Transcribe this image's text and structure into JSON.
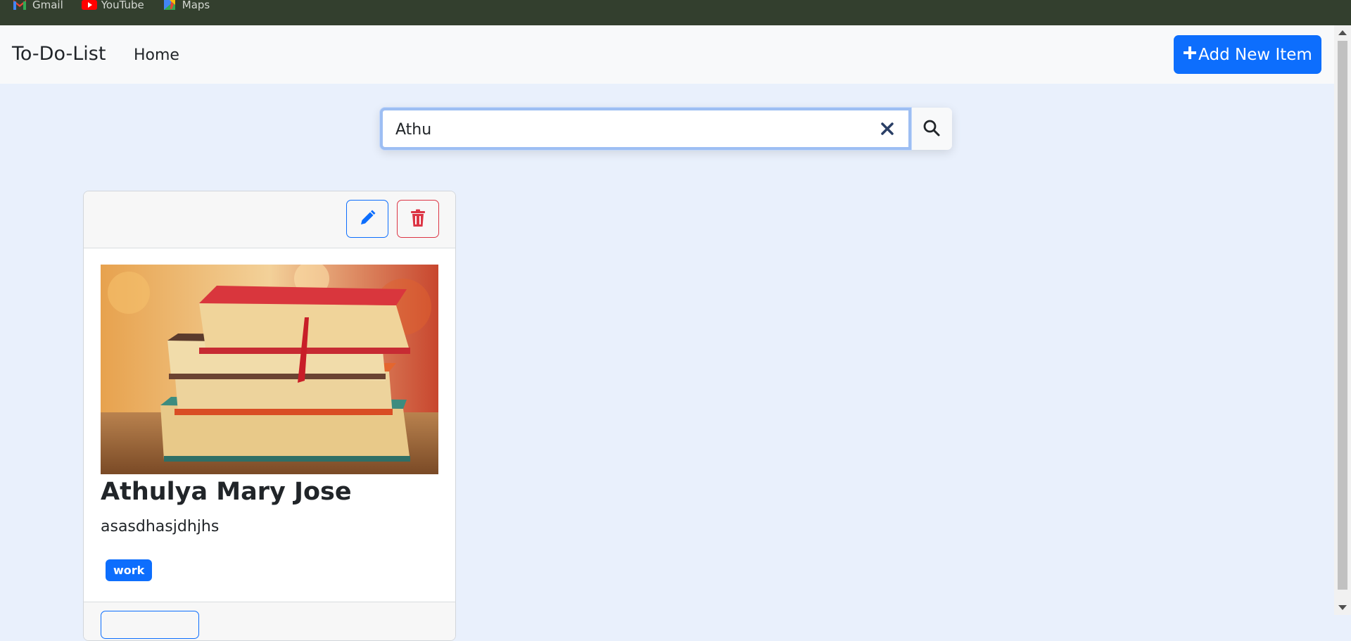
{
  "bookmarks": [
    {
      "label": "Gmail",
      "icon": "gmail-icon"
    },
    {
      "label": "YouTube",
      "icon": "youtube-icon"
    },
    {
      "label": "Maps",
      "icon": "maps-icon"
    }
  ],
  "navbar": {
    "brand": "To-Do-List",
    "home_label": "Home",
    "add_label": "Add New Item"
  },
  "search": {
    "value": "Athu",
    "clear_icon": "close-icon",
    "search_icon": "search-icon"
  },
  "card": {
    "title": "Athulya Mary Jose",
    "description": "asasdhasjdhjhs",
    "tag": "work",
    "image": "stack-of-books-image",
    "edit_icon": "pencil-icon",
    "delete_icon": "trash-icon"
  },
  "colors": {
    "primary": "#0d6efd",
    "danger": "#dc3545",
    "page_bg": "#e9f0fc",
    "bookmark_bar": "#333f2e"
  }
}
